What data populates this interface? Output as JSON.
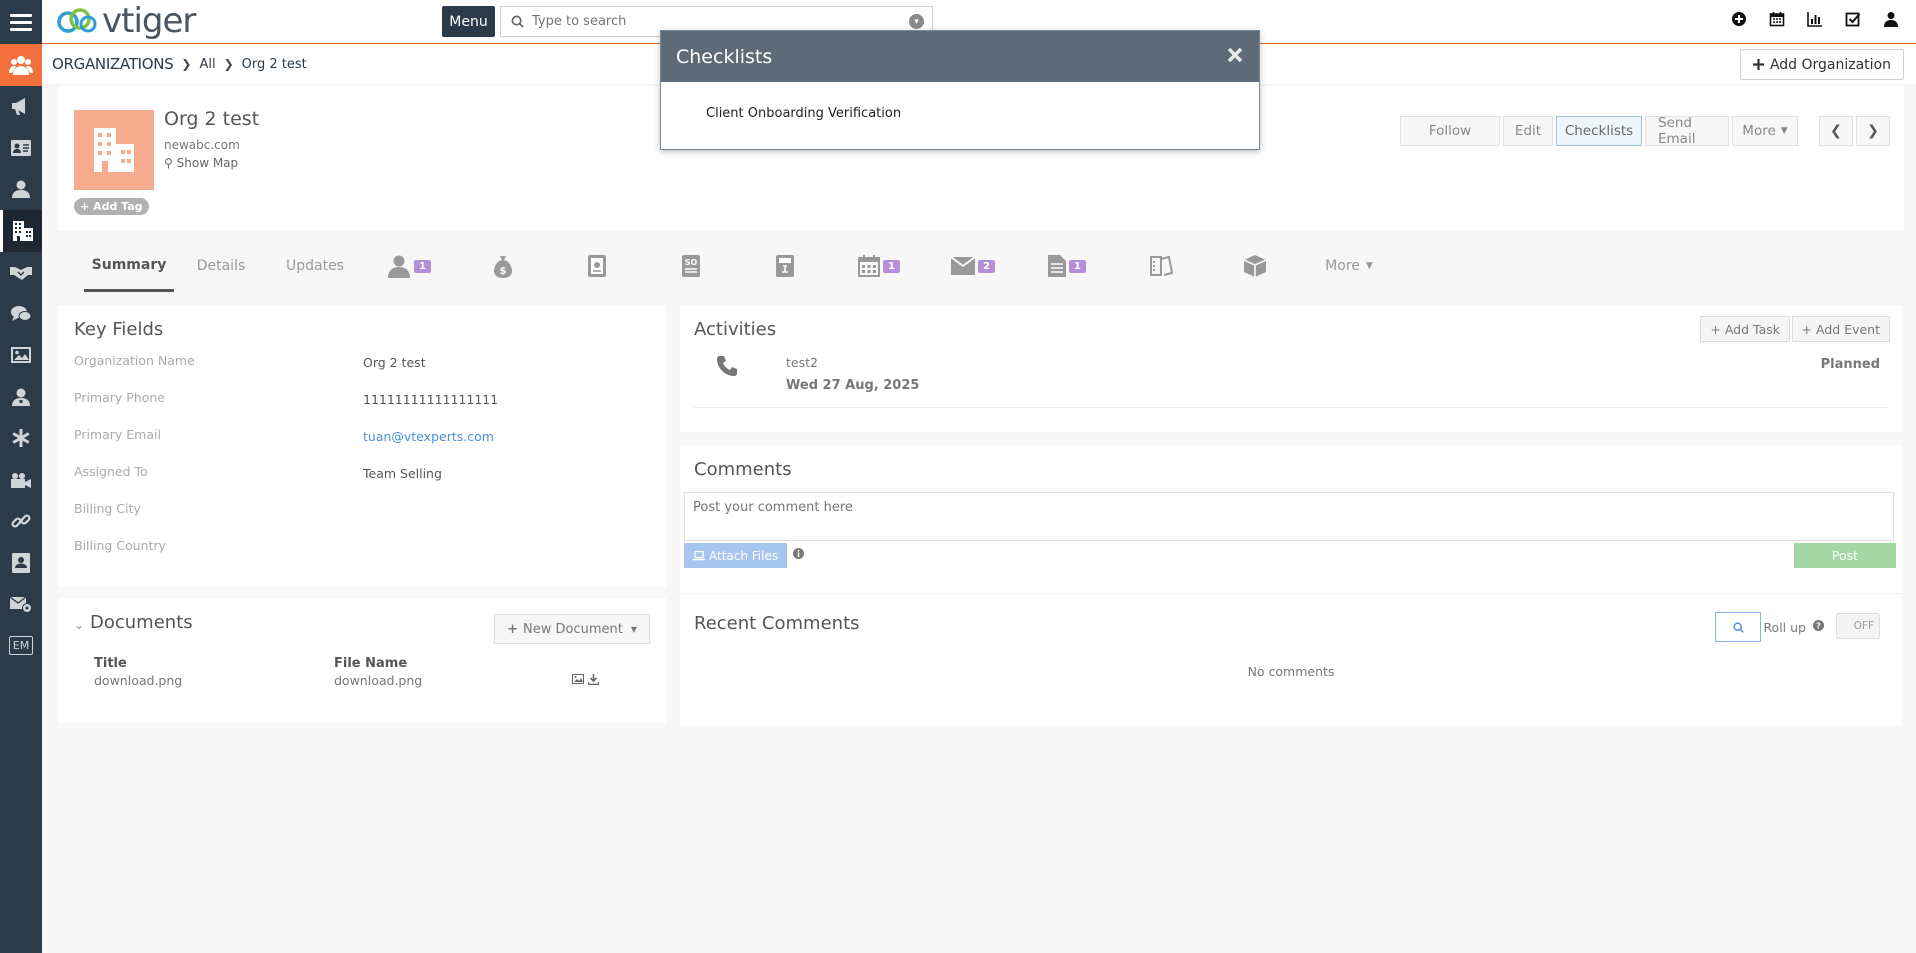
{
  "header": {
    "logo_text": "vtiger",
    "menu_label": "Menu",
    "search_placeholder": "Type to search"
  },
  "breadcrumb": {
    "module": "Organizations",
    "all": "All",
    "record": "Org 2 test",
    "add_button": "Add Organization"
  },
  "record": {
    "name": "Org 2 test",
    "website": "newabc.com",
    "show_map": "Show Map",
    "add_tag": "Add Tag",
    "actions": [
      "Follow",
      "Edit",
      "Checklists",
      "Send Email",
      "More"
    ]
  },
  "tabs": {
    "summary": "Summary",
    "details": "Details",
    "updates": "Updates",
    "contacts_count": "1",
    "activities_count": "1",
    "emails_count": "2",
    "documents_count": "1",
    "more": "More"
  },
  "key_fields": {
    "title": "Key Fields",
    "rows": [
      {
        "label": "Organization Name",
        "value": "Org 2 test"
      },
      {
        "label": "Primary Phone",
        "value": "11111111111111111"
      },
      {
        "label": "Primary Email",
        "value": "tuan@vtexperts.com"
      },
      {
        "label": "Assigned To",
        "value": "Team Selling"
      },
      {
        "label": "Billing City",
        "value": ""
      },
      {
        "label": "Billing Country",
        "value": ""
      }
    ]
  },
  "documents": {
    "title": "Documents",
    "new_button": "New Document",
    "col_title": "Title",
    "col_file": "File Name",
    "rows": [
      {
        "title": "download.png",
        "file": "download.png"
      }
    ]
  },
  "activities": {
    "title": "Activities",
    "add_task": "Add Task",
    "add_event": "Add Event",
    "items": [
      {
        "subject": "test2",
        "date": "Wed 27 Aug, 2025",
        "status": "Planned"
      }
    ]
  },
  "comments": {
    "title": "Comments",
    "placeholder": "Post your comment here",
    "attach": "Attach Files",
    "post": "Post",
    "recent_title": "Recent Comments",
    "rollup": "Roll up",
    "toggle": "OFF",
    "empty": "No comments"
  },
  "modal": {
    "title": "Checklists",
    "items": [
      "Client Onboarding Verification"
    ]
  },
  "colors": {
    "sidebar": "#2c3b49",
    "accent": "#f36f3c",
    "badge": "#b58fd8",
    "modal_header": "#5c6b77"
  }
}
